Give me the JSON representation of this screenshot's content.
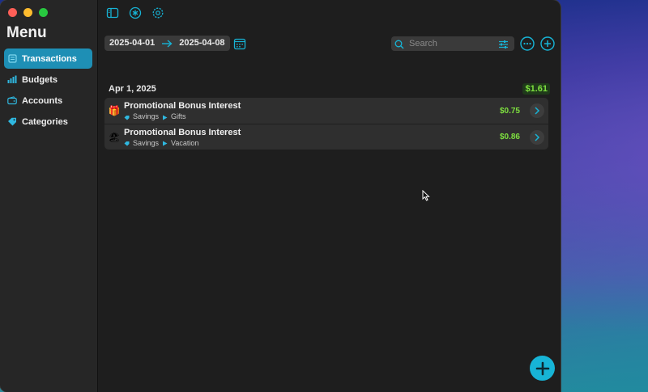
{
  "sidebar": {
    "title": "Menu",
    "items": [
      {
        "label": "Transactions",
        "icon": "transactions-icon",
        "active": true
      },
      {
        "label": "Budgets",
        "icon": "bar-chart-icon",
        "active": false
      },
      {
        "label": "Accounts",
        "icon": "wallet-icon",
        "active": false
      },
      {
        "label": "Categories",
        "icon": "tag-icon",
        "active": false
      }
    ]
  },
  "toolbar": {
    "date_start": "2025-04-01",
    "date_end": "2025-04-08",
    "search_placeholder": "Search"
  },
  "transactions": {
    "day_label": "Apr 1, 2025",
    "day_total": "$1.61",
    "items": [
      {
        "emoji": "🎁",
        "title": "Promotional Bonus Interest",
        "account": "Savings",
        "category": "Gifts",
        "amount": "$0.75"
      },
      {
        "emoji": "🏖",
        "title": "Promotional Bonus Interest",
        "account": "Savings",
        "category": "Vacation",
        "amount": "$0.86"
      }
    ]
  },
  "colors": {
    "accent": "#17b4d6",
    "active_nav": "#1e8fb5",
    "positive": "#7ee03f"
  }
}
